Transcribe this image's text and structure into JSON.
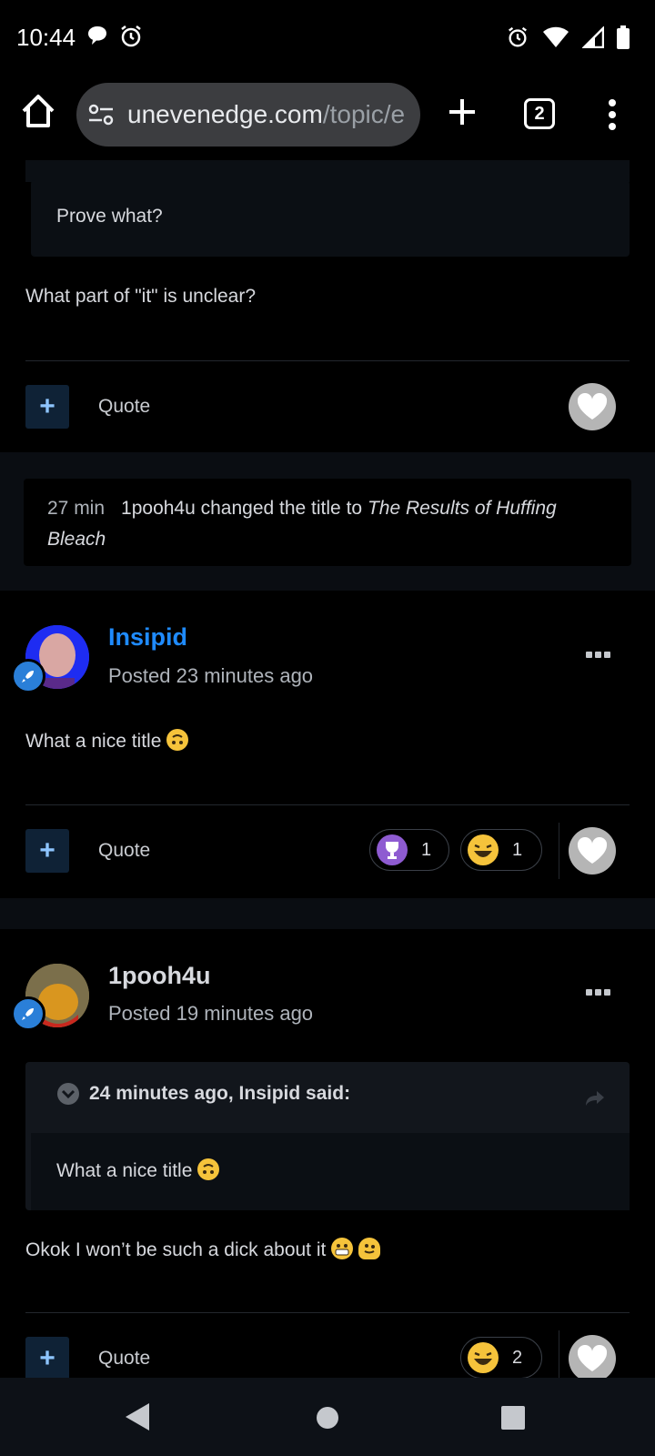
{
  "status_bar": {
    "time": "10:44",
    "left_icons": [
      "chat-bubble-icon",
      "alarm-icon"
    ],
    "right_icons": [
      "alarm-icon",
      "wifi-icon",
      "signal-icon",
      "battery-icon"
    ]
  },
  "browser": {
    "url_domain": "unevenedge.com",
    "url_path": "/topic/e",
    "tab_count": "2"
  },
  "posts": {
    "first_quote_text": "Prove what?",
    "first_reply_text": "What part of \"it\" is unclear?",
    "first_quote_label": "Quote",
    "event": {
      "time": "27 min",
      "text": "1pooh4u changed the title to",
      "title": "The Results of Huffing Bleach"
    },
    "insipid": {
      "author": "Insipid",
      "author_color": "#1f8bff",
      "posted": "Posted 23 minutes ago",
      "text": "What a nice title",
      "quote_label": "Quote",
      "reactions": [
        {
          "icon": "trophy-icon",
          "count": "1"
        },
        {
          "icon": "laughing-emoji-icon",
          "count": "1"
        }
      ]
    },
    "pooh": {
      "author": "1pooh4u",
      "posted": "Posted 19 minutes ago",
      "quote_header": "24 minutes ago, Insipid said:",
      "quote_text": "What a nice title",
      "text": "Okok I won’t be such a dick about it",
      "quote_label": "Quote",
      "reactions": [
        {
          "icon": "laughing-emoji-icon",
          "count": "2"
        }
      ]
    }
  }
}
